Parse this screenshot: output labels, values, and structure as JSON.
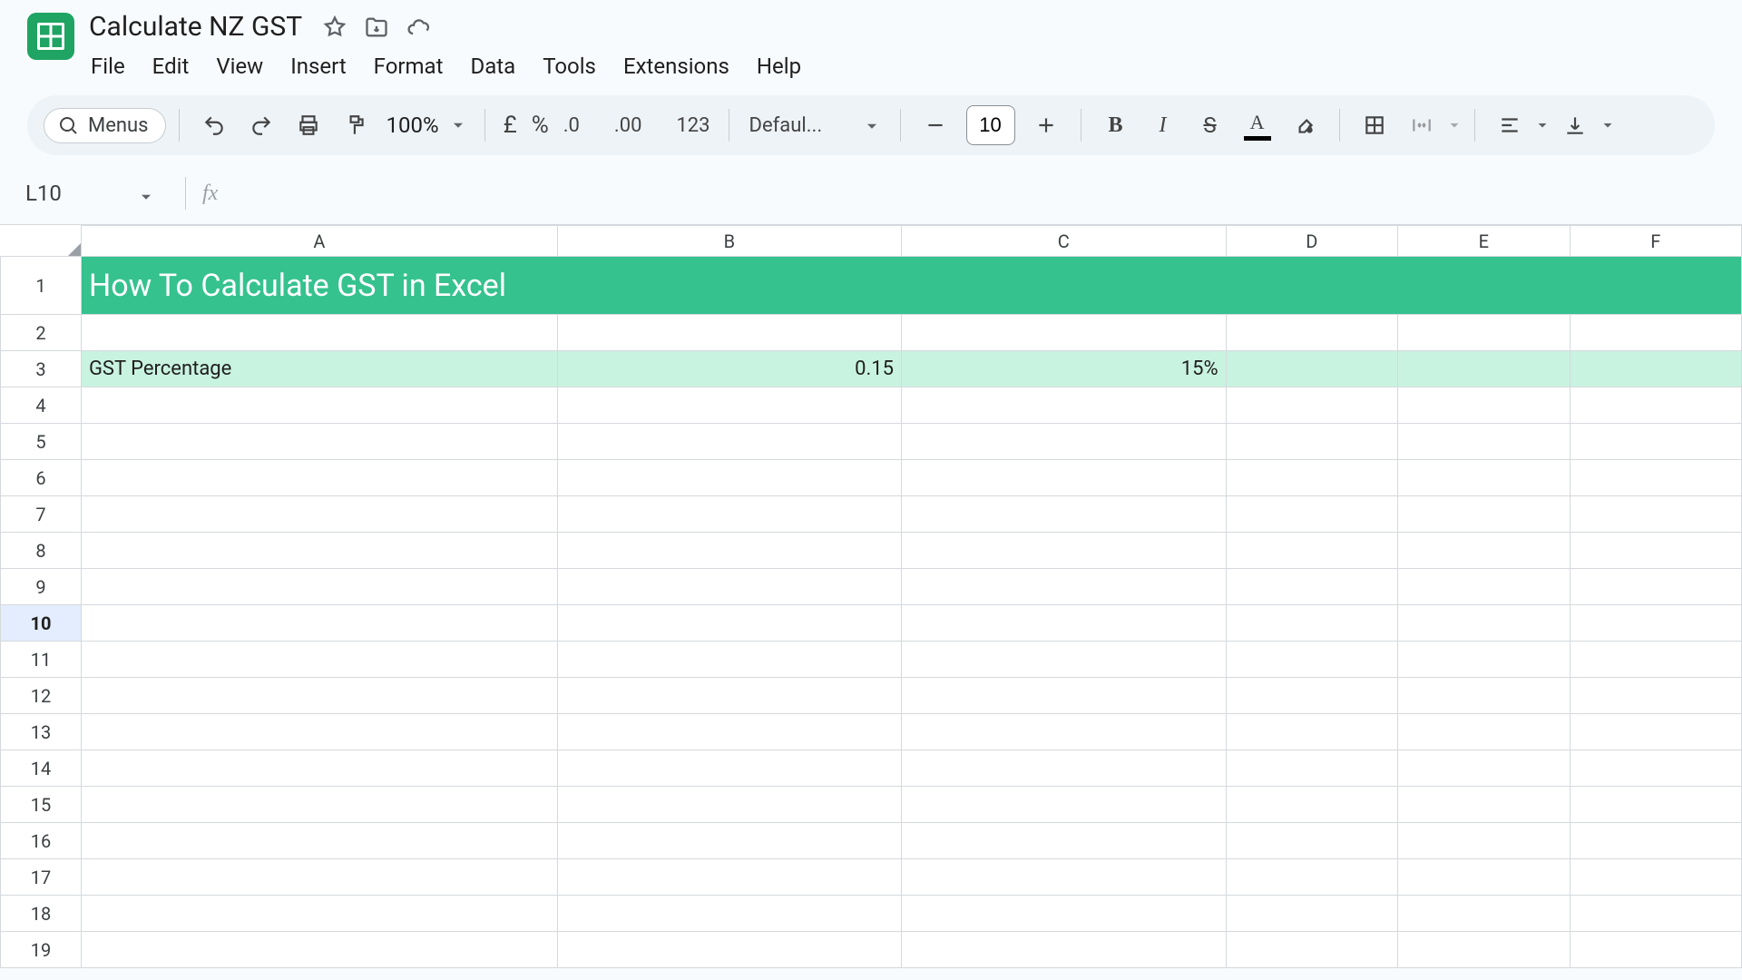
{
  "doc": {
    "title": "Calculate NZ GST"
  },
  "menu": {
    "file": "File",
    "edit": "Edit",
    "view": "View",
    "insert": "Insert",
    "format": "Format",
    "data": "Data",
    "tools": "Tools",
    "extensions": "Extensions",
    "help": "Help"
  },
  "toolbar": {
    "menus": "Menus",
    "zoom": "100%",
    "currency": "£",
    "percent": "%",
    "dec_dec": ".0",
    "inc_dec": ".00",
    "num_format": "123",
    "font_name": "Defaul...",
    "font_size": "10",
    "bold": "B",
    "italic": "I",
    "strike": "S",
    "textcolor": "A"
  },
  "namebox": {
    "ref": "L10",
    "fx": "fx",
    "formula": ""
  },
  "columns": [
    "A",
    "B",
    "C",
    "D",
    "E",
    "F"
  ],
  "selected_row": 10,
  "cells": {
    "r1": {
      "A": "How To Calculate GST in Excel"
    },
    "r3": {
      "A": "GST Percentage",
      "B": "0.15",
      "C": "15%"
    }
  },
  "chart_data": {
    "type": "table",
    "title": "How To Calculate GST in Excel",
    "columns": [
      "A",
      "B",
      "C"
    ],
    "rows": [
      {
        "A": "GST Percentage",
        "B": 0.15,
        "C": "15%"
      }
    ]
  }
}
